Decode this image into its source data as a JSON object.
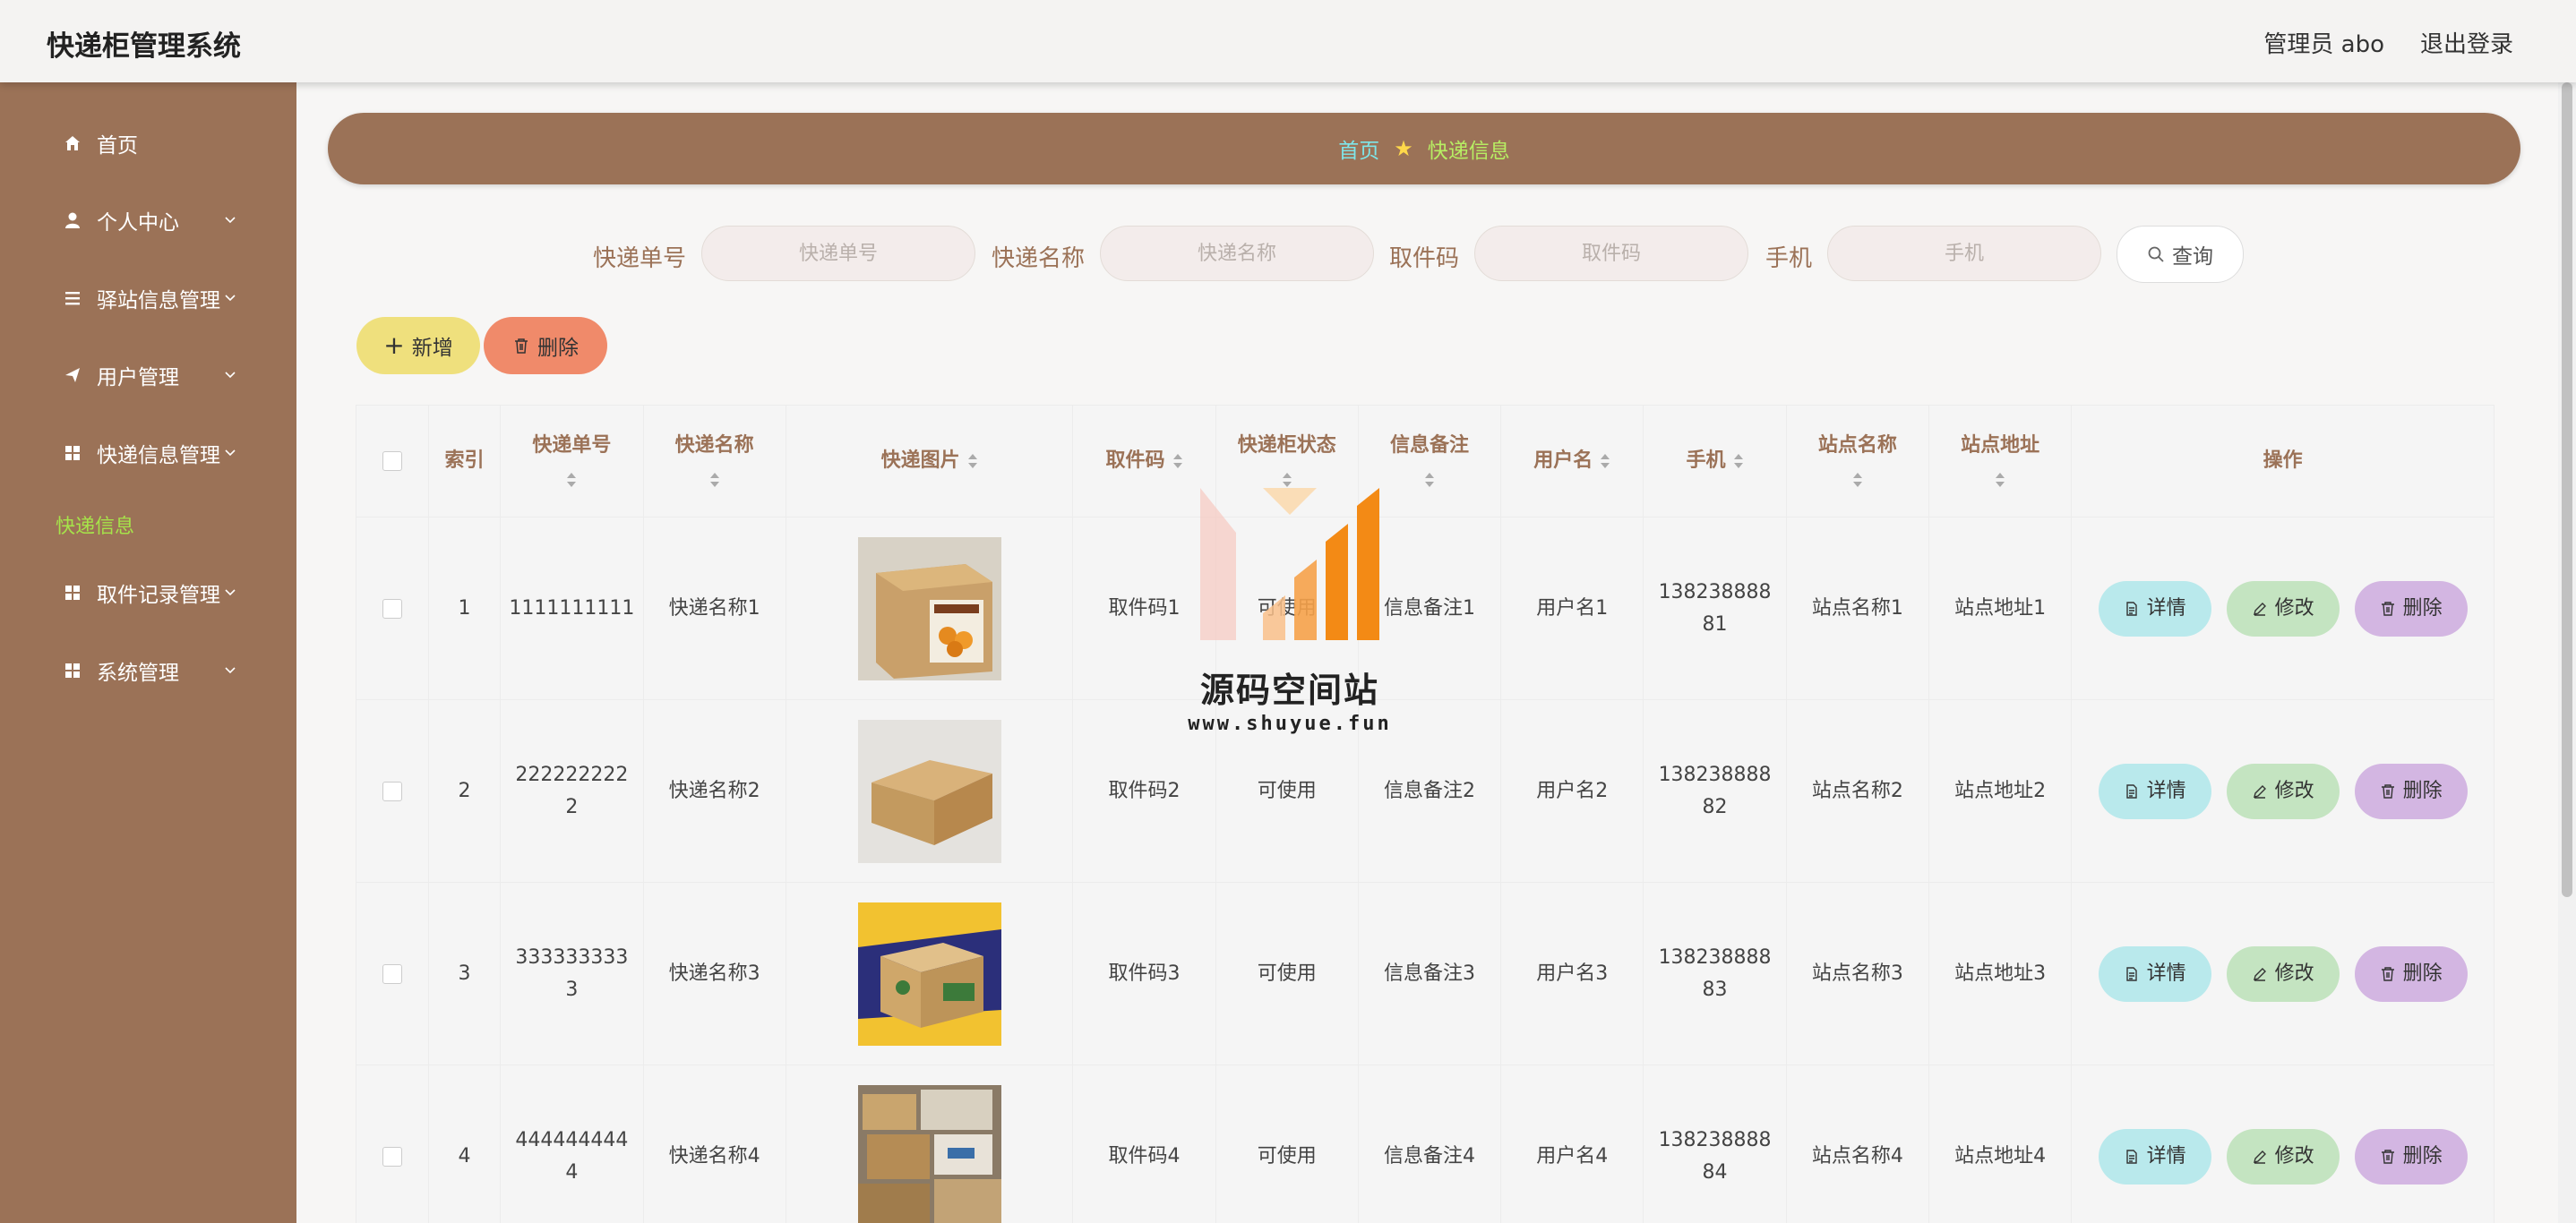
{
  "header": {
    "title": "快递柜管理系统",
    "user_label": "管理员 abo",
    "logout_label": "退出登录"
  },
  "sidebar": {
    "items": [
      {
        "label": "首页",
        "icon": "home-icon"
      },
      {
        "label": "个人中心",
        "icon": "user-icon"
      },
      {
        "label": "驿站信息管理",
        "icon": "list-icon"
      },
      {
        "label": "用户管理",
        "icon": "send-icon"
      },
      {
        "label": "快递信息管理",
        "icon": "grid-icon"
      },
      {
        "label": "取件记录管理",
        "icon": "grid-icon"
      },
      {
        "label": "系统管理",
        "icon": "grid-icon"
      }
    ],
    "active_sub": "快递信息"
  },
  "breadcrumb": {
    "home": "首页",
    "current": "快递信息"
  },
  "search": {
    "fields": [
      {
        "label": "快递单号",
        "placeholder": "快递单号"
      },
      {
        "label": "快递名称",
        "placeholder": "快递名称"
      },
      {
        "label": "取件码",
        "placeholder": "取件码"
      },
      {
        "label": "手机",
        "placeholder": "手机"
      }
    ],
    "query_label": "查询"
  },
  "actions": {
    "add_label": "新增",
    "delete_label": "删除"
  },
  "table": {
    "headers": [
      "索引",
      "快递单号",
      "快递名称",
      "快递图片",
      "取件码",
      "快递柜状态",
      "信息备注",
      "用户名",
      "手机",
      "站点名称",
      "站点地址",
      "操作"
    ],
    "rows": [
      {
        "index": "1",
        "tracking_line1": "1111111111",
        "tracking_line2": "",
        "name": "快递名称1",
        "code": "取件码1",
        "status": "可使用",
        "note": "信息备注1",
        "username": "用户名1",
        "phone_line1": "138238888",
        "phone_line2": "81",
        "site": "站点名称1",
        "address": "站点地址1"
      },
      {
        "index": "2",
        "tracking_line1": "222222222",
        "tracking_line2": "2",
        "name": "快递名称2",
        "code": "取件码2",
        "status": "可使用",
        "note": "信息备注2",
        "username": "用户名2",
        "phone_line1": "138238888",
        "phone_line2": "82",
        "site": "站点名称2",
        "address": "站点地址2"
      },
      {
        "index": "3",
        "tracking_line1": "333333333",
        "tracking_line2": "3",
        "name": "快递名称3",
        "code": "取件码3",
        "status": "可使用",
        "note": "信息备注3",
        "username": "用户名3",
        "phone_line1": "138238888",
        "phone_line2": "83",
        "site": "站点名称3",
        "address": "站点地址3"
      },
      {
        "index": "4",
        "tracking_line1": "444444444",
        "tracking_line2": "4",
        "name": "快递名称4",
        "code": "取件码4",
        "status": "可使用",
        "note": "信息备注4",
        "username": "用户名4",
        "phone_line1": "138238888",
        "phone_line2": "84",
        "site": "站点名称4",
        "address": "站点地址4"
      }
    ],
    "row_actions": {
      "detail": "详情",
      "edit": "修改",
      "delete": "删除"
    }
  },
  "watermark": {
    "text": "源码空间站",
    "url": "www.shuyue.fun"
  },
  "colors": {
    "sidebar": "#9b7257",
    "active_sub": "#a6e34a",
    "add_button": "#efe07d",
    "delete_button": "#f08a6a"
  }
}
